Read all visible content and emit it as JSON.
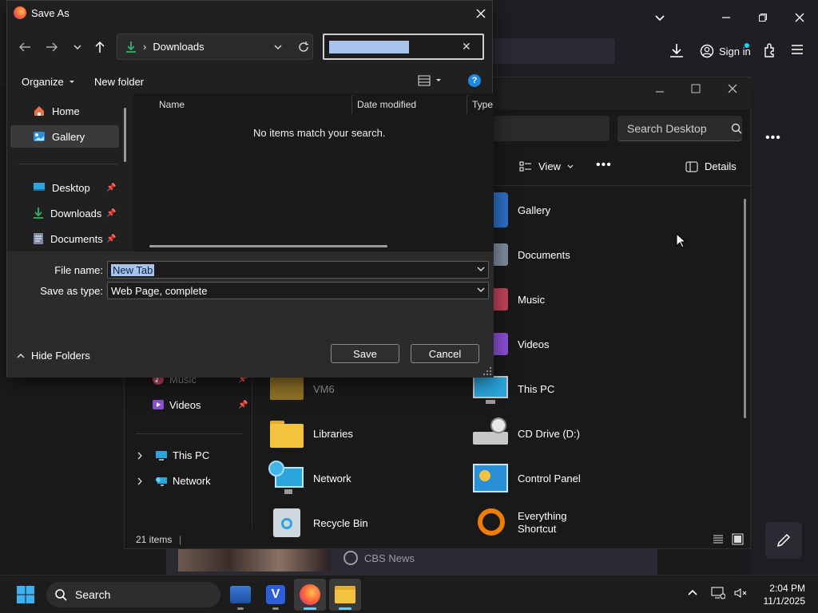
{
  "browser": {
    "signin_label": "Sign in",
    "news_label": "CBS News"
  },
  "explorer": {
    "search_placeholder": "Search Desktop",
    "view_label": "View",
    "details_label": "Details",
    "status_items": "21 items",
    "nav": [
      {
        "label": "Music",
        "icon": "music-icon",
        "pinned": true
      },
      {
        "label": "Videos",
        "icon": "videos-icon",
        "pinned": true
      },
      {
        "label": "This PC",
        "icon": "pc-icon",
        "pinned": false
      },
      {
        "label": "Network",
        "icon": "network-icon",
        "pinned": false
      }
    ],
    "items_right": [
      {
        "label": "Gallery",
        "icon": "gallery-icon"
      },
      {
        "label": "Documents",
        "icon": "documents-icon"
      },
      {
        "label": "Music",
        "icon": "music-icon"
      },
      {
        "label": "Videos",
        "icon": "videos-icon"
      },
      {
        "label": "This PC",
        "icon": "pc-icon"
      },
      {
        "label": "CD Drive (D:)",
        "icon": "cd-drive-icon"
      },
      {
        "label": "Control Panel",
        "icon": "control-panel-icon"
      },
      {
        "label": "Everything Shortcut",
        "icon": "everything-icon"
      }
    ],
    "items_left": [
      {
        "label": "VM6",
        "icon": "folder-icon"
      },
      {
        "label": "Libraries",
        "icon": "folder-icon"
      },
      {
        "label": "Network",
        "icon": "network-icon"
      },
      {
        "label": "Recycle Bin",
        "icon": "recycle-bin-icon"
      }
    ]
  },
  "dialog": {
    "title": "Save As",
    "path_label": "Downloads",
    "toolbar": {
      "organize": "Organize",
      "new_folder": "New folder"
    },
    "nav": [
      {
        "label": "Home",
        "icon": "home-icon",
        "pinned": false
      },
      {
        "label": "Gallery",
        "icon": "gallery-icon",
        "pinned": false
      },
      {
        "label": "Desktop",
        "icon": "desktop-icon",
        "pinned": true
      },
      {
        "label": "Downloads",
        "icon": "downloads-icon",
        "pinned": true
      },
      {
        "label": "Documents",
        "icon": "documents-icon",
        "pinned": true
      }
    ],
    "columns": {
      "name": "Name",
      "date_modified": "Date modified",
      "type": "Type"
    },
    "empty_message": "No items match your search.",
    "file_name_label": "File name:",
    "file_name_value": "New Tab",
    "save_type_label": "Save as type:",
    "save_type_value": "Web Page, complete",
    "hide_folders": "Hide Folders",
    "save_button": "Save",
    "cancel_button": "Cancel"
  },
  "taskbar": {
    "search_placeholder": "Search",
    "time": "2:04 PM",
    "date": "11/1/2025"
  },
  "colors": {
    "accent": "#60cdff",
    "selection": "#a9c4ec",
    "folder": "#f3c33d"
  }
}
